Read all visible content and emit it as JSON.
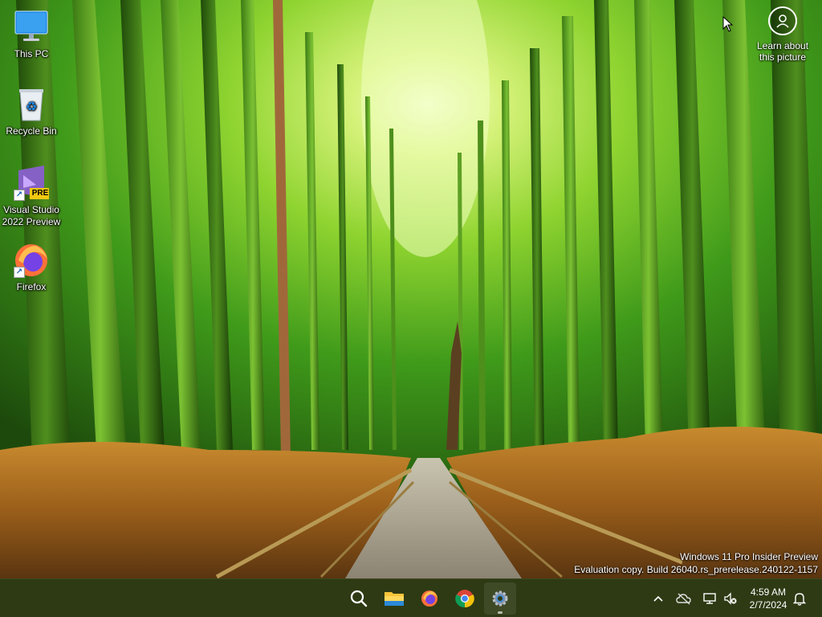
{
  "desktop": {
    "icons": [
      {
        "label": "This PC",
        "icon": "monitor-icon"
      },
      {
        "label": "Recycle Bin",
        "icon": "recycle-bin-icon"
      },
      {
        "label": "Visual Studio 2022 Preview",
        "icon": "visual-studio-icon",
        "badge": "PRE"
      },
      {
        "label": "Firefox",
        "icon": "firefox-icon"
      }
    ],
    "spotlight_label": "Learn about this picture"
  },
  "watermark": {
    "line1": "Windows 11 Pro Insider Preview",
    "line2": "Evaluation copy. Build 26040.rs_prerelease.240122-1157"
  },
  "taskbar": {
    "apps": [
      {
        "name": "Search",
        "icon": "search-icon"
      },
      {
        "name": "File Explorer",
        "icon": "folder-icon"
      },
      {
        "name": "Firefox",
        "icon": "firefox-icon"
      },
      {
        "name": "Google Chrome",
        "icon": "chrome-icon"
      },
      {
        "name": "Settings",
        "icon": "settings-gear-icon",
        "running": true
      }
    ],
    "tray": {
      "icons": [
        "chevron-up-icon",
        "onedrive-offline-icon",
        "network-icon",
        "volume-muted-icon",
        "notification-bell-icon"
      ]
    },
    "clock": {
      "time": "4:59 AM",
      "date": "2/7/2024"
    }
  },
  "colors": {
    "taskbar_bg": "#2e3a14",
    "accent_vs": "#8661c5",
    "pre_badge": "#f2c811"
  }
}
